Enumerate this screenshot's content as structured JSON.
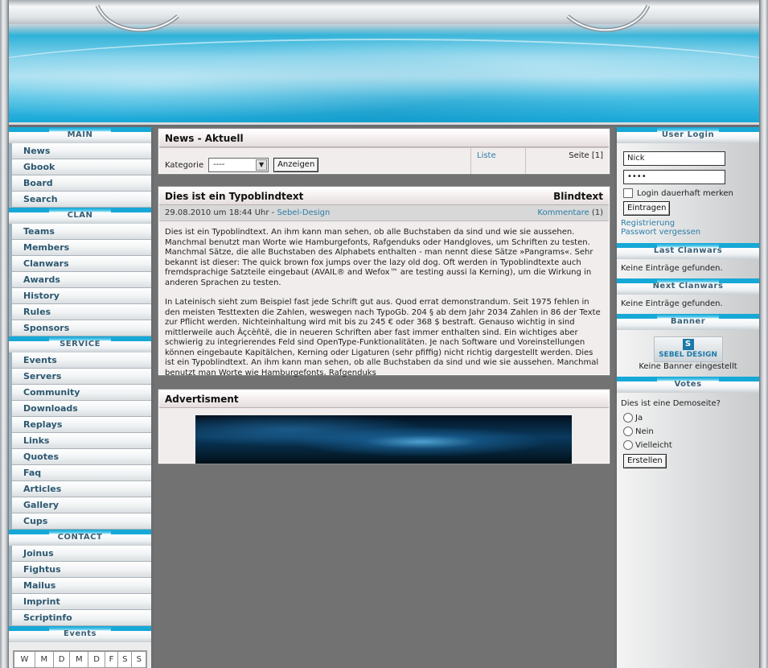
{
  "nav": {
    "main": {
      "title": "MAIN",
      "items": [
        "News",
        "Gbook",
        "Board",
        "Search"
      ]
    },
    "clan": {
      "title": "CLAN",
      "items": [
        "Teams",
        "Members",
        "Clanwars",
        "Awards",
        "History",
        "Rules",
        "Sponsors"
      ]
    },
    "service": {
      "title": "SERVICE",
      "items": [
        "Events",
        "Servers",
        "Community",
        "Downloads",
        "Replays",
        "Links",
        "Quotes",
        "Faq",
        "Articles",
        "Gallery",
        "Cups"
      ]
    },
    "contact": {
      "title": "CONTACT",
      "items": [
        "Joinus",
        "Fightus",
        "Mailus",
        "Imprint",
        "Scriptinfo"
      ]
    },
    "events": {
      "title": "Events",
      "weekdays": [
        "W",
        "M",
        "D",
        "M",
        "D",
        "F",
        "S",
        "S"
      ]
    }
  },
  "news": {
    "title": "News - Aktuell",
    "category_label": "Kategorie",
    "category_value": "----",
    "show_button": "Anzeigen",
    "list_link": "Liste",
    "page_label": "Seite [1]"
  },
  "article": {
    "title": "Dies ist ein Typoblindtext",
    "tag": "Blindtext",
    "date": "29.08.2010 um 18:44 Uhr - ",
    "author": "Sebel-Design",
    "comments_link": "Kommentare",
    "comments_count": " (1)",
    "paragraph1": "Dies ist ein Typoblindtext. An ihm kann man sehen, ob alle Buchstaben da sind und wie sie aussehen. Manchmal benutzt man Worte wie Hamburgefonts, Rafgenduks oder Handgloves, um Schriften zu testen. Manchmal Sätze, die alle Buchstaben des Alphabets enthalten - man nennt diese Sätze »Pangrams«. Sehr bekannt ist dieser: The quick brown fox jumps over the lazy old dog. Oft werden in Typoblindtexte auch fremdsprachige Satzteile eingebaut (AVAIL® and Wefox™ are testing aussi la Kerning), um die Wirkung in anderen Sprachen zu testen.",
    "paragraph2": "In Lateinisch sieht zum Beispiel fast jede Schrift gut aus. Quod errat demonstrandum. Seit 1975 fehlen in den meisten Testtexten die Zahlen, weswegen nach TypoGb. 204 § ab dem Jahr 2034 Zahlen in 86 der Texte zur Pflicht werden. Nichteinhaltung wird mit bis zu 245 € oder 368 $ bestraft. Genauso wichtig in sind mittlerweile auch Âçcèñtë, die in neueren Schriften aber fast immer enthalten sind. Ein wichtiges aber schwierig zu integrierendes Feld sind OpenType-Funktionalitäten. Je nach Software und Voreinstellungen können eingebaute Kapitälchen, Kerning oder Ligaturen (sehr pfiffig) nicht richtig dargestellt werden. Dies ist ein Typoblindtext. An ihm kann man sehen, ob alle Buchstaben da sind und wie sie aussehen. Manchmal benutzt man Worte wie Hamburgefonts, Rafgenduks"
  },
  "advert": {
    "title": "Advertisment"
  },
  "login": {
    "title": "User Login",
    "username": "Nick",
    "password": "••••",
    "remember_label": "Login dauerhaft merken",
    "submit": "Eintragen",
    "register_link": "Registrierung",
    "forgot_link": "Passwort vergessen"
  },
  "last_clanwars": {
    "title": "Last Clanwars",
    "text": "Keine Einträge gefunden."
  },
  "next_clanwars": {
    "title": "Next Clanwars",
    "text": "Keine Einträge gefunden."
  },
  "banner": {
    "title": "Banner",
    "logo_text": "SEBEL DESIGN",
    "caption": "Keine Banner eingestellt"
  },
  "votes": {
    "title": "Votes",
    "question": "Dies ist eine Demoseite?",
    "options": [
      "Ja",
      "Nein",
      "Vielleicht"
    ],
    "submit": "Erstellen"
  },
  "colors": {
    "accent": "#16a8d6",
    "nav_text": "#2c5870",
    "link": "#2c7ea8"
  }
}
